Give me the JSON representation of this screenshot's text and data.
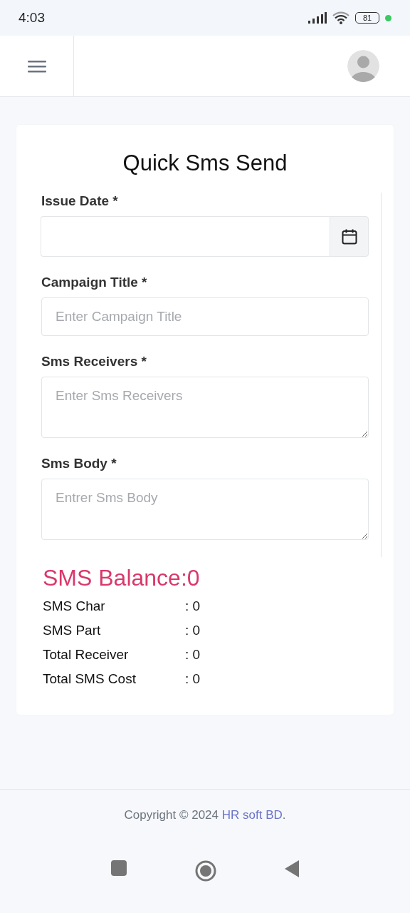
{
  "status_bar": {
    "time": "4:03",
    "battery": "81"
  },
  "title": "Quick Sms Send",
  "fields": [
    {
      "label": "Issue Date *",
      "kind": "date"
    },
    {
      "label": "Campaign Title *",
      "kind": "input",
      "placeholder": "Enter Campaign Title"
    },
    {
      "label": "Sms Receivers *",
      "kind": "textarea",
      "placeholder": "Enter Sms Receivers"
    },
    {
      "label": "Sms Body *",
      "kind": "textarea",
      "placeholder": "Entrer Sms Body"
    }
  ],
  "balance": "SMS Balance:0",
  "stats": [
    {
      "label": "SMS Char",
      "value": ": 0"
    },
    {
      "label": "SMS Part",
      "value": ": 0"
    },
    {
      "label": "Total Receiver",
      "value": ": 0"
    },
    {
      "label": "Total SMS Cost",
      "value": ": 0"
    }
  ],
  "footer": {
    "text": "Copyright © 2024",
    "link": "HR soft BD",
    "after": "."
  }
}
